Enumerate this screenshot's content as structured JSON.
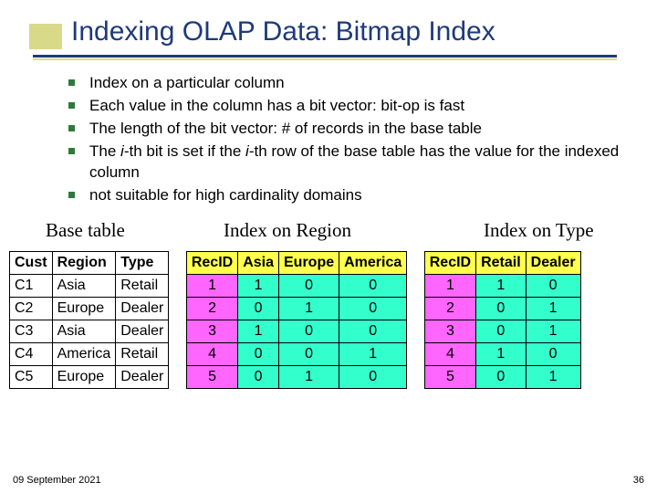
{
  "title": "Indexing OLAP Data: Bitmap Index",
  "bullets": [
    "Index on a particular column",
    "Each value in the column has a bit vector: bit-op is fast",
    "The length of the bit vector: # of records in the base table",
    "The i-th bit is set if the i-th row of the base table has the value for the indexed column",
    "not suitable for high cardinality domains"
  ],
  "labels": {
    "base": "Base table",
    "region": "Index on Region",
    "type": "Index on Type"
  },
  "base_table": {
    "headers": [
      "Cust",
      "Region",
      "Type"
    ],
    "rows": [
      [
        "C1",
        "Asia",
        "Retail"
      ],
      [
        "C2",
        "Europe",
        "Dealer"
      ],
      [
        "C3",
        "Asia",
        "Dealer"
      ],
      [
        "C4",
        "America",
        "Retail"
      ],
      [
        "C5",
        "Europe",
        "Dealer"
      ]
    ]
  },
  "region_index": {
    "headers": [
      "RecID",
      "Asia",
      "Europe",
      "America"
    ],
    "rows": [
      [
        "1",
        "1",
        "0",
        "0"
      ],
      [
        "2",
        "0",
        "1",
        "0"
      ],
      [
        "3",
        "1",
        "0",
        "0"
      ],
      [
        "4",
        "0",
        "0",
        "1"
      ],
      [
        "5",
        "0",
        "1",
        "0"
      ]
    ]
  },
  "type_index": {
    "headers": [
      "RecID",
      "Retail",
      "Dealer"
    ],
    "rows": [
      [
        "1",
        "1",
        "0"
      ],
      [
        "2",
        "0",
        "1"
      ],
      [
        "3",
        "0",
        "1"
      ],
      [
        "4",
        "1",
        "0"
      ],
      [
        "5",
        "0",
        "1"
      ]
    ]
  },
  "footer": {
    "date": "09 September 2021",
    "page": "36"
  }
}
